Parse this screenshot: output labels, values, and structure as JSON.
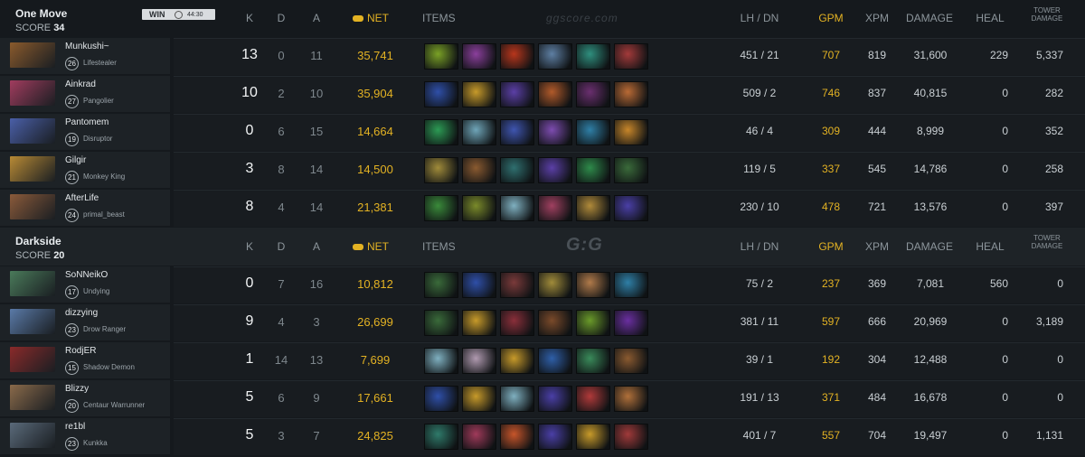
{
  "headers": {
    "k": "K",
    "d": "D",
    "a": "A",
    "net": "NET",
    "items": "ITEMS",
    "lhdn": "LH / DN",
    "gpm": "GPM",
    "xpm": "XPM",
    "damage": "DAMAGE",
    "heal": "HEAL",
    "tower": "TOWER DAMAGE"
  },
  "watermark_top": "ggscore.com",
  "watermark_mid": "G:G",
  "teams": [
    {
      "name": "One Move",
      "score_label": "SCORE",
      "score": "34",
      "result": "WIN",
      "duration": "44:30",
      "players": [
        {
          "name": "Munkushi~",
          "level": "26",
          "hero": "Lifestealer",
          "k": "13",
          "d": "0",
          "a": "11",
          "net": "35,741",
          "lhdn": "451 / 21",
          "gpm": "707",
          "xpm": "819",
          "damage": "31,600",
          "heal": "229",
          "tower": "5,337",
          "portrait": "#8a5a2c",
          "items": [
            "#7aa126",
            "#8b3f9c",
            "#b8361c",
            "#5e7fa3",
            "#2f8f7e",
            "#a33a3a"
          ]
        },
        {
          "name": "Ainkrad",
          "level": "27",
          "hero": "Pangolier",
          "k": "10",
          "d": "2",
          "a": "10",
          "net": "35,904",
          "lhdn": "509 / 2",
          "gpm": "746",
          "xpm": "837",
          "damage": "40,815",
          "heal": "0",
          "tower": "282",
          "portrait": "#a13c5e",
          "items": [
            "#2f4fa8",
            "#c79a2a",
            "#5b3fa6",
            "#b15a2a",
            "#6a2f6f",
            "#b96a35"
          ]
        },
        {
          "name": "Pantomem",
          "level": "19",
          "hero": "Disruptor",
          "k": "0",
          "d": "6",
          "a": "15",
          "net": "14,664",
          "lhdn": "46 / 4",
          "gpm": "309",
          "xpm": "444",
          "damage": "8,999",
          "heal": "0",
          "tower": "352",
          "portrait": "#4a5fa8",
          "items": [
            "#2c9a54",
            "#6fa5b8",
            "#3f55b0",
            "#7d4cb0",
            "#2f7fa6",
            "#c7862a"
          ]
        },
        {
          "name": "Gilgir",
          "level": "21",
          "hero": "Monkey King",
          "k": "3",
          "d": "8",
          "a": "14",
          "net": "14,500",
          "lhdn": "119 / 5",
          "gpm": "337",
          "xpm": "545",
          "damage": "14,786",
          "heal": "0",
          "tower": "258",
          "portrait": "#b88a35",
          "items": [
            "#a08b3a",
            "#8a5a30",
            "#2f6f6f",
            "#5b3fa6",
            "#2e8a4a",
            "#3a6a3a"
          ]
        },
        {
          "name": "AfterLife",
          "level": "24",
          "hero": "primal_beast",
          "k": "8",
          "d": "4",
          "a": "14",
          "net": "21,381",
          "lhdn": "230 / 10",
          "gpm": "478",
          "xpm": "721",
          "damage": "13,576",
          "heal": "0",
          "tower": "397",
          "portrait": "#8a5a3a",
          "items": [
            "#3a8a3a",
            "#7a8a2a",
            "#7fb0c0",
            "#a04060",
            "#b08a3a",
            "#4a3fa6"
          ]
        }
      ]
    },
    {
      "name": "Darkside",
      "score_label": "SCORE",
      "score": "20",
      "players": [
        {
          "name": "SoNNeikO",
          "level": "17",
          "hero": "Undying",
          "k": "0",
          "d": "7",
          "a": "16",
          "net": "10,812",
          "lhdn": "75 / 2",
          "gpm": "237",
          "xpm": "369",
          "damage": "7,081",
          "heal": "560",
          "tower": "0",
          "portrait": "#4a7a5a",
          "items": [
            "#3a6a3a",
            "#2f4fa8",
            "#7a3a3a",
            "#a08b3a",
            "#b07a4a",
            "#2f7fa6"
          ]
        },
        {
          "name": "dizzying",
          "level": "23",
          "hero": "Drow Ranger",
          "k": "9",
          "d": "4",
          "a": "3",
          "net": "26,699",
          "lhdn": "381 / 11",
          "gpm": "597",
          "xpm": "666",
          "damage": "20,969",
          "heal": "0",
          "tower": "3,189",
          "portrait": "#5a7aa8",
          "items": [
            "#3a6a3a",
            "#c79a2a",
            "#8a2f3a",
            "#7a4a2a",
            "#6a9a2a",
            "#6a2fa0"
          ]
        },
        {
          "name": "RodjER",
          "level": "15",
          "hero": "Shadow Demon",
          "k": "1",
          "d": "14",
          "a": "13",
          "net": "7,699",
          "lhdn": "39 / 1",
          "gpm": "192",
          "xpm": "304",
          "damage": "12,488",
          "heal": "0",
          "tower": "0",
          "portrait": "#8a2a2a",
          "items": [
            "#7fb0c0",
            "#b09ab0",
            "#c79a2a",
            "#2f5fa8",
            "#3a8a5a",
            "#8a5a30"
          ]
        },
        {
          "name": "Blizzy",
          "level": "20",
          "hero": "Centaur Warrunner",
          "k": "5",
          "d": "6",
          "a": "9",
          "net": "17,661",
          "lhdn": "191 / 13",
          "gpm": "371",
          "xpm": "484",
          "damage": "16,678",
          "heal": "0",
          "tower": "0",
          "portrait": "#8a6a4a",
          "items": [
            "#2f4fa8",
            "#c79a2a",
            "#7fb0c0",
            "#4a3fa6",
            "#b03a3a",
            "#b0703a"
          ]
        },
        {
          "name": "re1bl",
          "level": "23",
          "hero": "Kunkka",
          "k": "5",
          "d": "3",
          "a": "7",
          "net": "24,825",
          "lhdn": "401 / 7",
          "gpm": "557",
          "xpm": "704",
          "damage": "19,497",
          "heal": "0",
          "tower": "1,131",
          "portrait": "#5a6a7a",
          "items": [
            "#2f7a6a",
            "#a03a5a",
            "#c7552a",
            "#4a3fa6",
            "#c79a2a",
            "#a03a3a"
          ]
        }
      ]
    }
  ]
}
